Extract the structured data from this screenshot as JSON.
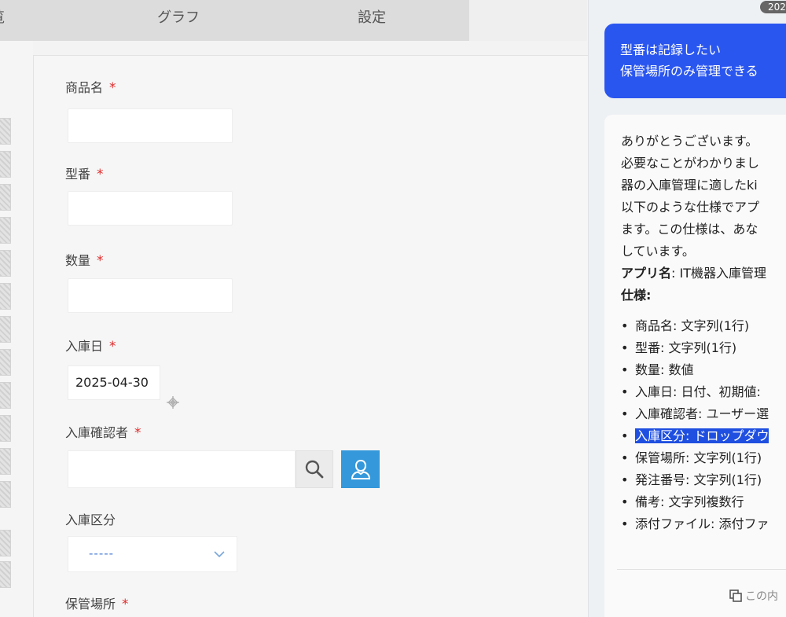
{
  "tabs": [
    {
      "label": "覧"
    },
    {
      "label": "グラフ"
    },
    {
      "label": "設定"
    }
  ],
  "form": {
    "fields": {
      "product_name": {
        "label": "商品名",
        "required": "*",
        "value": ""
      },
      "model_number": {
        "label": "型番",
        "required": "*",
        "value": ""
      },
      "quantity": {
        "label": "数量",
        "required": "*",
        "value": ""
      },
      "arrival_date": {
        "label": "入庫日",
        "required": "*",
        "value": "2025-04-30"
      },
      "confirmer": {
        "label": "入庫確認者",
        "required": "*",
        "value": ""
      },
      "arrival_type": {
        "label": "入庫区分",
        "value": "-----"
      },
      "storage_location": {
        "label": "保管場所",
        "required": "*"
      }
    }
  },
  "chat": {
    "timestamp": "202",
    "user_message": [
      "型番は記録したい",
      "保管場所のみ管理できる"
    ],
    "bot_message": {
      "lines": [
        "ありがとうございます。",
        "必要なことがわかりまし",
        "器の入庫管理に適したki",
        "以下のような仕様でアプ",
        "ます。この仕様は、あな",
        "しています。"
      ],
      "app_name_label": "アプリ名",
      "app_name_value": ": IT機器入庫管理",
      "spec_label": "仕様",
      "spec_label_suffix": ":",
      "spec_items": [
        "商品名: 文字列(1行)",
        "型番: 文字列(1行)",
        "数量: 数値",
        "入庫日: 日付、初期値:",
        "入庫確認者: ユーザー選",
        "入庫区分: ドロップダウ",
        "保管場所: 文字列(1行)",
        "発注番号: 文字列(1行)",
        "備考: 文字列複数行",
        "添付ファイル: 添付ファ"
      ],
      "highlighted_index": 5,
      "copy_label": "この内"
    }
  },
  "colors": {
    "accent_blue": "#2a56f0",
    "user_button": "#3498db",
    "required": "#e02a2a",
    "highlight": "#1f4fe0"
  },
  "icons": [
    "search-icon",
    "user-icon",
    "calendar-icon",
    "chevron-down-icon",
    "copy-icon"
  ]
}
